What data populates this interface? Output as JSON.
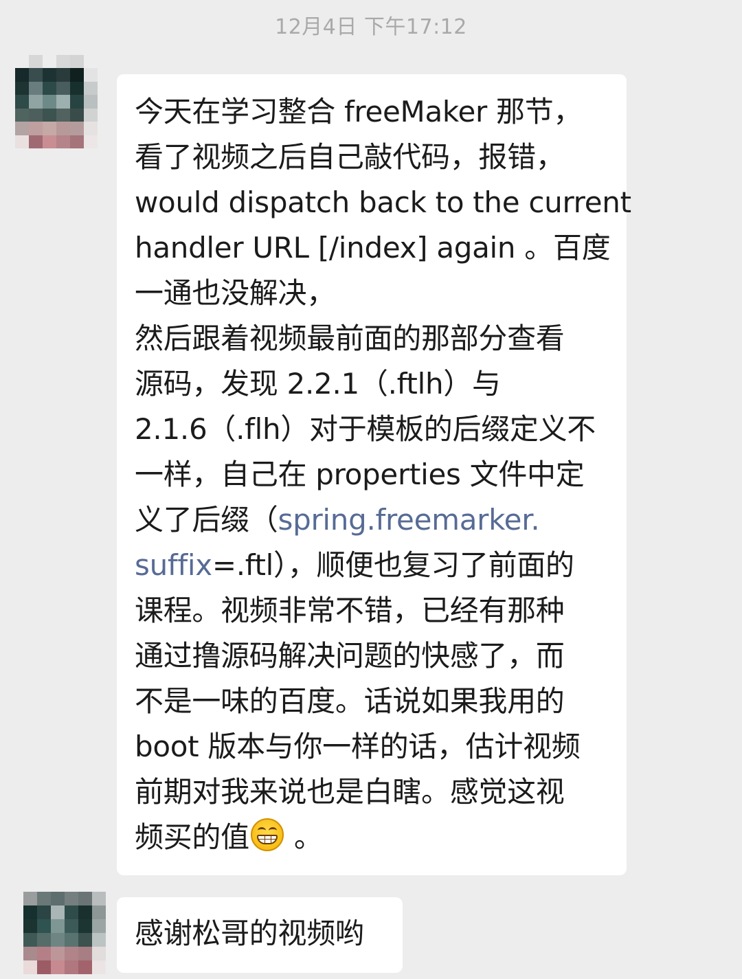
{
  "timestamp": "12月4日 下午17:12",
  "messages": [
    {
      "lines": [
        {
          "text": "今天在学习整合 freeMaker 那节，"
        },
        {
          "text": "看了视频之后自己敲代码，报错，"
        },
        {
          "text": "would dispatch back to the current"
        },
        {
          "text": "handler URL [/index] again 。百度"
        },
        {
          "text": "一通也没解决，"
        },
        {
          "text": "然后跟着视频最前面的那部分查看"
        },
        {
          "text": "源码，发现 2.2.1（.ftlh）与"
        },
        {
          "text": "2.1.6（.flh）对于模板的后缀定义不"
        },
        {
          "text": "一样，自己在 properties 文件中定"
        },
        {
          "pre": "义了后缀（",
          "link": "spring.freemarker."
        },
        {
          "link": "suffix",
          "post": "=.ftl），顺便也复习了前面的"
        },
        {
          "text": "课程。视频非常不错，已经有那种"
        },
        {
          "text": "通过撸源码解决问题的快感了，而"
        },
        {
          "text": "不是一味的百度。话说如果我用的"
        },
        {
          "text": "boot 版本与你一样的话，估计视频"
        },
        {
          "text": "前期对我来说也是白瞎。感觉这视"
        },
        {
          "pre": "频买的值",
          "emoji": "grinning-face-icon",
          "post": " 。"
        }
      ]
    },
    {
      "lines": [
        {
          "text": "感谢松哥的视频哟"
        }
      ]
    }
  ],
  "avatar_colors": {
    "avatar1": [
      "#ededed",
      "#d7d7d7",
      "#ededed",
      "#d8d8d8",
      "#d4d4d4",
      "#ededed",
      "#17292a",
      "#3a4d4e",
      "#1d3333",
      "#2a3b3b",
      "#10201f",
      "#e3e3e3",
      "#1d3432",
      "#6a7d7e",
      "#2b4a48",
      "#4a5d5e",
      "#18302d",
      "#c8cbcb",
      "#2e4a49",
      "#90a4a3",
      "#6d8a88",
      "#9bb0af",
      "#284442",
      "#b9c0bf",
      "#50645f",
      "#4d5f5c",
      "#3c5350",
      "#51625f",
      "#3a4c49",
      "#d0d3d2",
      "#b4a3a3",
      "#bf9f9f",
      "#c5a9a6",
      "#b79999",
      "#b59c9c",
      "#e6e2e2",
      "#eae0e0",
      "#a06a72",
      "#c98e94",
      "#b4848a",
      "#a5737a",
      "#ece6e6"
    ],
    "avatar2": [
      "#9a9d9d",
      "#6a7877",
      "#5e6d6d",
      "#757f7f",
      "#6b7474",
      "#b9bdbd",
      "#16302f",
      "#2b4544",
      "#a9b6b5",
      "#2f4c4a",
      "#19302f",
      "#8c9796",
      "#1b3331",
      "#2f5350",
      "#7e9694",
      "#3c5a58",
      "#1c3432",
      "#9aa5a4",
      "#3f5a56",
      "#566c69",
      "#6f8583",
      "#587370",
      "#3b524f",
      "#bcc4c3",
      "#a98a8d",
      "#b47f86",
      "#bd969a",
      "#b08489",
      "#a67e83",
      "#e2dcdc",
      "#eadada",
      "#9b5c66",
      "#c78a91",
      "#b0777f",
      "#a2636d",
      "#ece4e4"
    ]
  }
}
